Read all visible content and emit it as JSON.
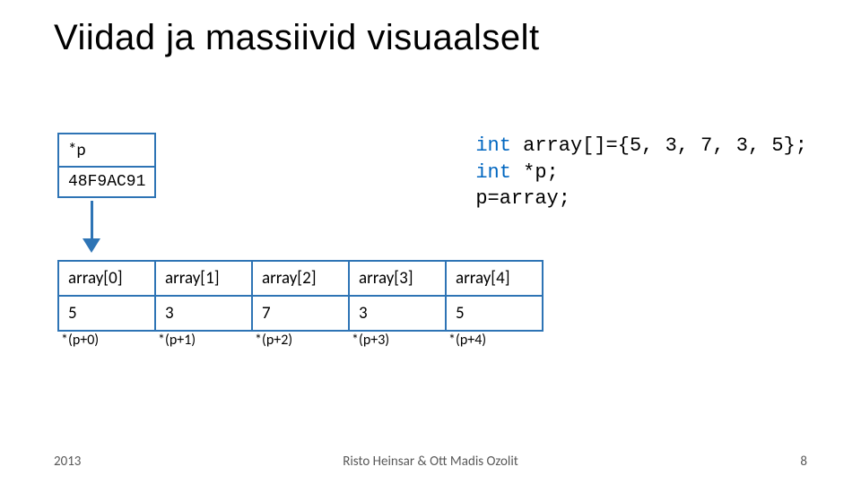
{
  "title": "Viidad ja massiivid visuaalselt",
  "pointer": {
    "name": "*p",
    "value": "48F9AC91"
  },
  "code": {
    "line1_kw": "int",
    "line1_rest": " array[]={5, 3, 7, 3, 5};",
    "line2_kw": "int",
    "line2_rest": " *p;",
    "line3": "p=array;"
  },
  "array_indices": [
    "array[0]",
    "array[1]",
    "array[2]",
    "array[3]",
    "array[4]"
  ],
  "array_values": [
    "5",
    "3",
    "7",
    "3",
    "5"
  ],
  "ptr_labels": [
    "*(p+0)",
    "*(p+1)",
    "*(p+2)",
    "*(p+3)",
    "*(p+4)"
  ],
  "footer": {
    "left": "2013",
    "center": "Risto Heinsar & Ott Madis Ozolit",
    "right": "8"
  },
  "colors": {
    "accent": "#2e74b5",
    "code_keyword": "#0066c0",
    "footer": "#595959"
  }
}
